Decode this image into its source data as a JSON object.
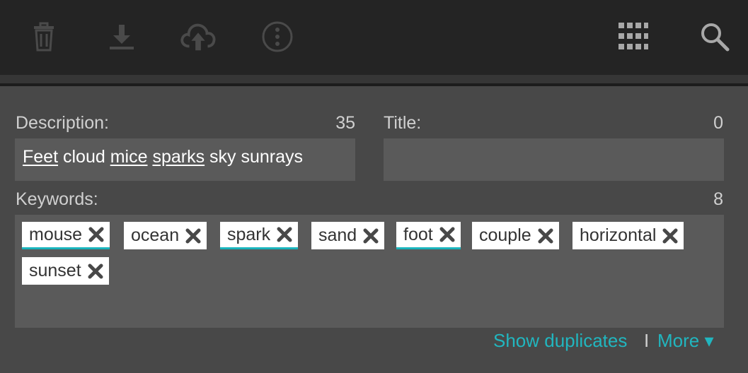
{
  "toolbar": {
    "icons": [
      "trash-icon",
      "download-icon",
      "cloud-upload-icon",
      "more-options-icon",
      "grid-icon",
      "search-icon"
    ]
  },
  "description": {
    "label": "Description:",
    "count": "35",
    "words": [
      {
        "text": "Feet",
        "underlined": true
      },
      {
        "text": "cloud",
        "underlined": false
      },
      {
        "text": "mice",
        "underlined": true
      },
      {
        "text": "sparks",
        "underlined": true
      },
      {
        "text": "sky",
        "underlined": false
      },
      {
        "text": "sunrays",
        "underlined": false
      }
    ]
  },
  "title": {
    "label": "Title:",
    "count": "0",
    "value": ""
  },
  "keywords": {
    "label": "Keywords:",
    "count": "8",
    "tags": [
      "mouse",
      "ocean",
      "spark",
      "sand",
      "foot",
      "couple",
      "horizontal",
      "sunset"
    ],
    "marked": [
      "mouse",
      "spark",
      "foot"
    ]
  },
  "footer": {
    "show_duplicates": "Show duplicates",
    "separator": "I",
    "more": "More ▾"
  },
  "colors": {
    "accent": "#21b6bf",
    "toolbar_bg": "#242424",
    "panel_bg": "#484848",
    "field_bg": "#5a5a5a"
  }
}
